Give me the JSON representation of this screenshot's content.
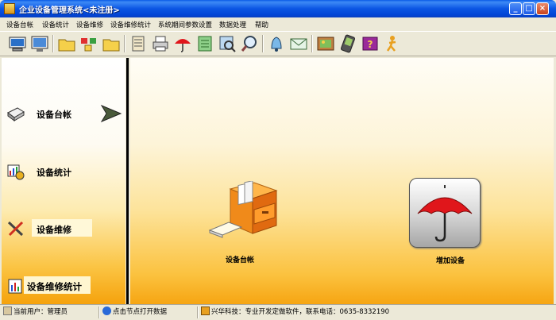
{
  "window": {
    "title": "企业设备管理系统<未注册>",
    "minimize_label": "_",
    "maximize_label": "□",
    "close_label": "×"
  },
  "menu": [
    {
      "label": "设备台帐"
    },
    {
      "label": "设备统计"
    },
    {
      "label": "设备维修"
    },
    {
      "label": "设备维修统计"
    },
    {
      "label": "系统期间参数设置"
    },
    {
      "label": "数据处理"
    },
    {
      "label": "帮助"
    }
  ],
  "toolbar": [
    {
      "icon": "computer-icon"
    },
    {
      "icon": "monitor-icon"
    },
    {
      "icon": "folder-icon"
    },
    {
      "icon": "folder-tree-icon"
    },
    {
      "icon": "folder-open-icon"
    },
    {
      "icon": "scroll-icon"
    },
    {
      "icon": "print-icon"
    },
    {
      "icon": "umbrella-icon"
    },
    {
      "icon": "notebook-icon"
    },
    {
      "icon": "image-search-icon"
    },
    {
      "icon": "magnifier-icon"
    },
    {
      "icon": "bell-icon"
    },
    {
      "icon": "envelope-icon"
    },
    {
      "icon": "picture-icon"
    },
    {
      "icon": "pda-icon"
    },
    {
      "icon": "help-book-icon"
    },
    {
      "icon": "exit-person-icon"
    }
  ],
  "sidebar": {
    "items": [
      {
        "label": "设备台帐",
        "icon": "book-icon"
      },
      {
        "label": "设备统计",
        "icon": "chart-icon"
      },
      {
        "label": "设备维修",
        "icon": "tools-icon"
      },
      {
        "label": "设备维修统计",
        "icon": "stats-icon"
      }
    ]
  },
  "main": {
    "buttons": [
      {
        "label": "设备台帐",
        "icon": "file-cabinet-icon"
      },
      {
        "label": "增加设备",
        "icon": "umbrella-icon"
      }
    ]
  },
  "status": {
    "user": "当前用户：管理员",
    "hint": "点击节点打开数据",
    "company": "兴华科技：专业开发定做软件，联系电话：0635-8332190"
  },
  "colors": {
    "titlebar": "#0b55e3",
    "panel_gradient_top": "#fffdf6",
    "panel_gradient_bottom": "#f6a512",
    "umbrella_red": "#e0161b"
  }
}
